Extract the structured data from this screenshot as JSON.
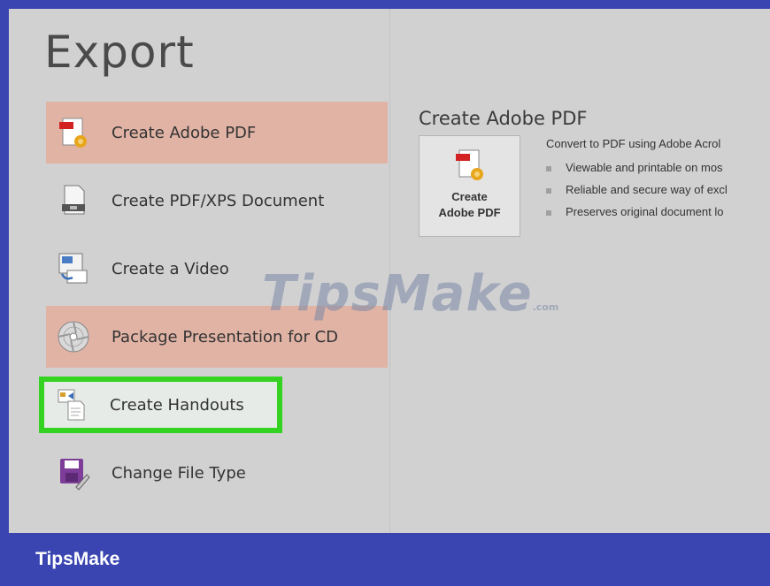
{
  "title": "Export",
  "menu": [
    {
      "label": "Create Adobe PDF",
      "icon": "pdf-doc-icon"
    },
    {
      "label": "Create PDF/XPS Document",
      "icon": "xps-doc-icon"
    },
    {
      "label": "Create a Video",
      "icon": "video-icon"
    },
    {
      "label": "Package Presentation for CD",
      "icon": "cd-icon"
    },
    {
      "label": "Create Handouts",
      "icon": "handouts-icon"
    },
    {
      "label": "Change File Type",
      "icon": "file-type-icon"
    }
  ],
  "panel": {
    "title": "Create Adobe PDF",
    "button_line1": "Create",
    "button_line2": "Adobe PDF",
    "description": "Convert to PDF using Adobe Acrol",
    "bullets": [
      "Viewable and printable on mos",
      "Reliable and secure way of excl",
      "Preserves original document lo"
    ]
  },
  "watermark": {
    "text": "TipsMake",
    "suffix": ".com"
  },
  "footer": {
    "brand": "TipsMake"
  },
  "colors": {
    "selected": "#e1b3a5",
    "highlight_border": "#35d321",
    "frame": "#3a45b2"
  }
}
